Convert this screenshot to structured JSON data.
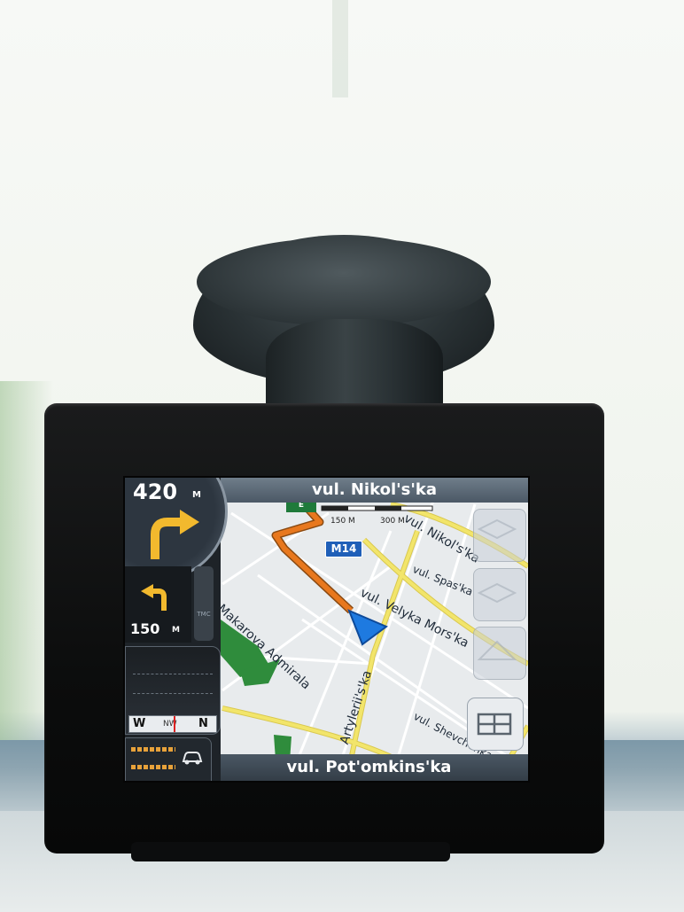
{
  "navigation": {
    "current_street": "vul. Nikol's'ka",
    "next_street": "vul. Pot'omkins'ka",
    "turn_distance": "420",
    "turn_distance_unit": "M",
    "next_turn_distance": "150",
    "next_turn_distance_unit": "M"
  },
  "map": {
    "route_sign": "M14",
    "scale_labels": [
      "150 M",
      "300 M"
    ],
    "streets": [
      "vul. Nikol's'ka",
      "vul. Spas'ka",
      "vul. Velyka Mors'ka",
      "Makarova Admirala",
      "Artylerii's'ka",
      "vul. Shevchenka"
    ]
  },
  "traffic": {
    "tmc_label": "TMC"
  },
  "compass": {
    "west": "W",
    "north_west": "NW",
    "north": "N"
  },
  "colors": {
    "route": "#e8781e",
    "road_yellow": "#f2e56b",
    "map_background": "#e8ebed",
    "park_green": "#2f8c3c",
    "position_arrow": "#1e7ae0",
    "street_label_bar": "#4b5865"
  },
  "icons": {
    "turn_right": "turn-right-arrow-icon",
    "turn_left": "turn-left-arrow-icon",
    "position": "vehicle-position-icon",
    "car": "car-icon",
    "menu": "menu-grid-icon"
  }
}
